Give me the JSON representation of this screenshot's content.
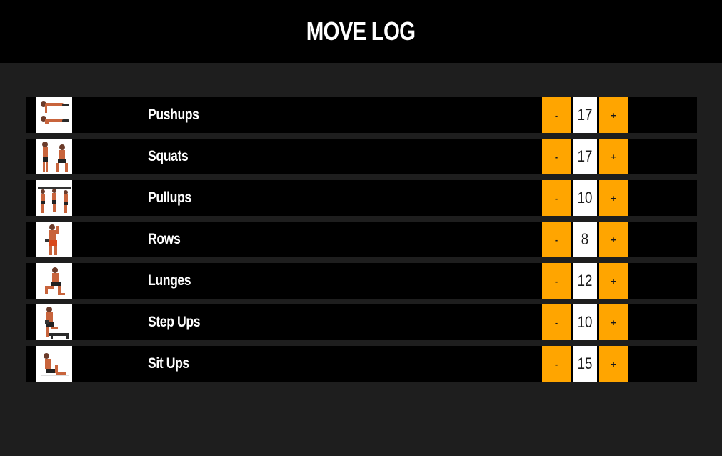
{
  "header": {
    "title": "MOVE LOG"
  },
  "exercises": [
    {
      "name": "Pushups",
      "count": "17",
      "icon": "pushup-figure-icon"
    },
    {
      "name": "Squats",
      "count": "17",
      "icon": "squat-figure-icon"
    },
    {
      "name": "Pullups",
      "count": "10",
      "icon": "pullup-figure-icon"
    },
    {
      "name": "Rows",
      "count": "8",
      "icon": "row-figure-icon"
    },
    {
      "name": "Lunges",
      "count": "12",
      "icon": "lunge-figure-icon"
    },
    {
      "name": "Step Ups",
      "count": "10",
      "icon": "stepup-figure-icon"
    },
    {
      "name": "Sit Ups",
      "count": "15",
      "icon": "situp-figure-icon"
    }
  ],
  "controls": {
    "decrement_label": "-",
    "increment_label": "+"
  },
  "colors": {
    "accent": "#ffa500",
    "background": "#1e1e1e",
    "header_bg": "#000000",
    "row_bg": "#000000",
    "text": "#ffffff"
  }
}
